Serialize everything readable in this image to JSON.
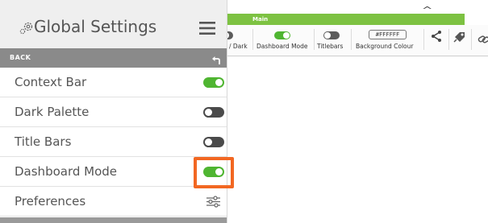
{
  "panel": {
    "title": "Global Settings",
    "gear_icon": "gear-icon",
    "menu_icon": "hamburger-menu-icon",
    "back_label": "BACK",
    "back_icon": "back-arrow-icon",
    "items": [
      {
        "label": "Context Bar",
        "control": "toggle",
        "state": "on"
      },
      {
        "label": "Dark Palette",
        "control": "toggle",
        "state": "off"
      },
      {
        "label": "Title Bars",
        "control": "toggle",
        "state": "off"
      },
      {
        "label": "Dashboard Mode",
        "control": "toggle",
        "state": "on",
        "highlighted": true
      },
      {
        "label": "Preferences",
        "control": "icon",
        "icon": "sliders-icon"
      }
    ]
  },
  "ribbon": {
    "section_title": "Main",
    "items": [
      {
        "label": "/ Dark",
        "state": "off"
      },
      {
        "label": "Dashboard Mode",
        "state": "on"
      },
      {
        "label": "Titlebars",
        "state": "off"
      },
      {
        "label": "Background Colour",
        "value": "#FFFFFF"
      }
    ],
    "icons": [
      "share-icon",
      "tag-icon",
      "link-icon"
    ],
    "collapse_icon": "chevron-up-icon"
  },
  "colors": {
    "accent_green": "#4fb531",
    "ribbon_green": "#7dc242",
    "highlight_orange": "#f26722",
    "back_bar_gray": "#8a8a8a"
  }
}
